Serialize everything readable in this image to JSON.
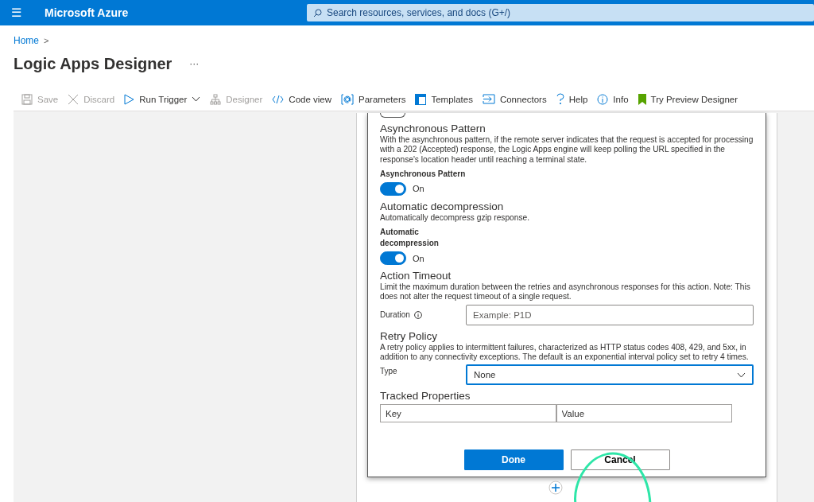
{
  "topbar": {
    "menu": "☰",
    "brand": "Microsoft Azure",
    "search": {
      "placeholder": "Search resources, services, and docs (G+/)"
    }
  },
  "breadcrumb": {
    "items": [
      "Home"
    ],
    "separator": ">"
  },
  "page": {
    "title": "Logic Apps Designer",
    "more": "···"
  },
  "toolbar": [
    {
      "label": "Save",
      "disabled": true
    },
    {
      "label": "Discard",
      "disabled": true
    },
    {
      "label": "Run Trigger",
      "disabled": false,
      "dropdown": true
    },
    {
      "label": "Designer",
      "disabled": true
    },
    {
      "label": "Code view",
      "disabled": false
    },
    {
      "label": "Parameters",
      "disabled": false
    },
    {
      "label": "Templates",
      "disabled": false
    },
    {
      "label": "Connectors",
      "disabled": false
    },
    {
      "label": "Help",
      "disabled": false
    },
    {
      "label": "Info",
      "disabled": false
    },
    {
      "label": "Try Preview Designer",
      "disabled": false
    }
  ],
  "settings": {
    "sections": [
      {
        "kind": "toggle",
        "title": "Asynchronous Pattern",
        "description": "With the asynchronous pattern, if the remote server indicates that the request is accepted for processing with a 202 (Accepted) response, the Logic Apps engine will keep polling the URL specified in the response's location header until reaching a terminal state.",
        "label": "Asynchronous Pattern",
        "on": true,
        "state_text": "On"
      },
      {
        "kind": "toggle",
        "title": "Automatic decompression",
        "description": "Automatically decompress gzip response.",
        "label": "Automatic decompression",
        "on": true,
        "state_text": "On"
      },
      {
        "kind": "field",
        "title": "Action Timeout",
        "description": "Limit the maximum duration between the retries and asynchronous responses for this action. Note: This does not alter the request timeout of a single request.",
        "label": "Duration",
        "placeholder": "Example: P1D"
      },
      {
        "kind": "select",
        "title": "Retry Policy",
        "description": "A retry policy applies to intermittent failures, characterized as HTTP status codes 408, 429, and 5xx, in addition to any connectivity exceptions. The default is an exponential interval policy set to retry 4 times.",
        "label": "Type",
        "value": "None",
        "focused": true
      },
      {
        "kind": "table",
        "title": "Tracked Properties",
        "key_placeholder": "Key",
        "value_placeholder": "Value"
      }
    ],
    "buttons": [
      {
        "label": "Done",
        "primary": true
      },
      {
        "label": "Cancel",
        "primary": false
      }
    ]
  }
}
